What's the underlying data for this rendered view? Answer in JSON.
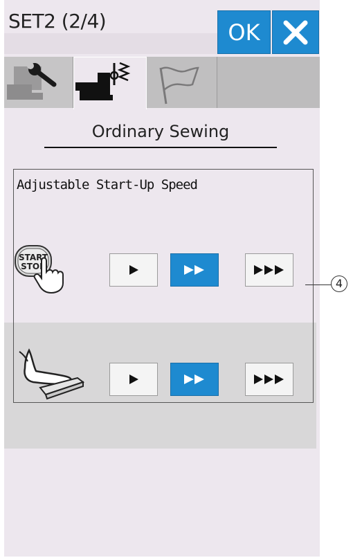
{
  "header": {
    "title": "SET2 (2/4)",
    "ok_label": "OK",
    "close_icon": "close-icon"
  },
  "tabs": [
    {
      "icon": "wrench-machine-icon",
      "active": false
    },
    {
      "icon": "needle-stitch-machine-icon",
      "active": true
    },
    {
      "icon": "flag-icon",
      "active": false
    },
    {
      "icon": "",
      "active": false
    }
  ],
  "section": {
    "title": "Ordinary Sewing"
  },
  "panel": {
    "title": "Adjustable Start-Up Speed",
    "start_stop_icon_text": [
      "START",
      "STOP"
    ],
    "start_stop_row": {
      "icon": "start-stop-button-icon",
      "options": [
        "slow",
        "medium",
        "fast"
      ],
      "selected": "medium"
    },
    "foot_control_row": {
      "icon": "foot-control-icon",
      "options": [
        "slow",
        "medium",
        "fast"
      ],
      "selected": "medium"
    }
  },
  "callout": {
    "label": "4"
  },
  "colors": {
    "accent": "#1e8ad0",
    "screen_bg": "#ede7ee",
    "tab_bg": "#bdbcbd"
  }
}
